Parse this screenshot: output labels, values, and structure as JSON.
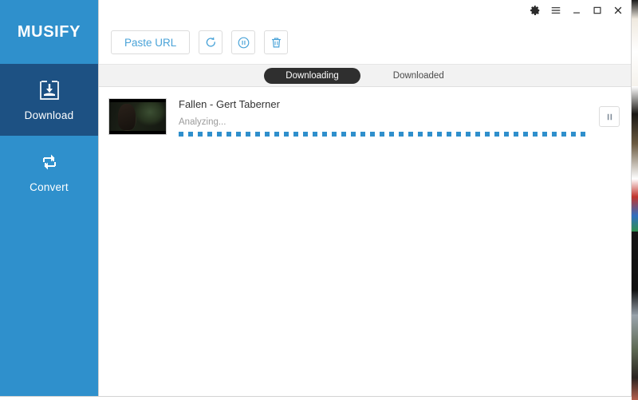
{
  "app": {
    "brand": "MUSIFY"
  },
  "window_controls": [
    {
      "name": "settings-gear-button",
      "icon": "gear-icon",
      "glyph": "⚙"
    },
    {
      "name": "menu-button",
      "icon": "hamburger-menu-icon",
      "glyph": "≡"
    },
    {
      "name": "minimize-button",
      "icon": "minimize-icon",
      "glyph": "＿"
    },
    {
      "name": "maximize-button",
      "icon": "maximize-icon",
      "glyph": "□"
    },
    {
      "name": "close-button",
      "icon": "close-icon",
      "glyph": "✕"
    }
  ],
  "sidebar": {
    "items": [
      {
        "label": "Download",
        "icon": "download-icon",
        "active": true
      },
      {
        "label": "Convert",
        "icon": "convert-loop-icon",
        "active": false
      }
    ]
  },
  "toolbar": {
    "paste_url_label": "Paste URL",
    "buttons": [
      {
        "name": "refresh-button",
        "icon": "refresh-arrow-icon"
      },
      {
        "name": "pause-all-button",
        "icon": "pause-circle-icon"
      },
      {
        "name": "delete-button",
        "icon": "trash-icon"
      }
    ]
  },
  "tabs": [
    {
      "label": "Downloading",
      "active": true
    },
    {
      "label": "Downloaded",
      "active": false
    }
  ],
  "downloads": [
    {
      "title": "Fallen - Gert Taberner",
      "status": "Analyzing...",
      "progress_percent": 0,
      "action_icon": "pause-icon",
      "thumbnail": "video-thumbnail-woman-dark-forest"
    }
  ],
  "colors": {
    "sidebar_blue": "#2f90cc",
    "sidebar_active_navy": "#1d5183",
    "accent_blue": "#2f8fcc",
    "link_blue": "#4aa3d8",
    "tab_active_dark": "#2f2f2f",
    "tabbar_gray": "#f2f2f2",
    "title_text": "#333333",
    "status_text": "#9b9b9b"
  }
}
